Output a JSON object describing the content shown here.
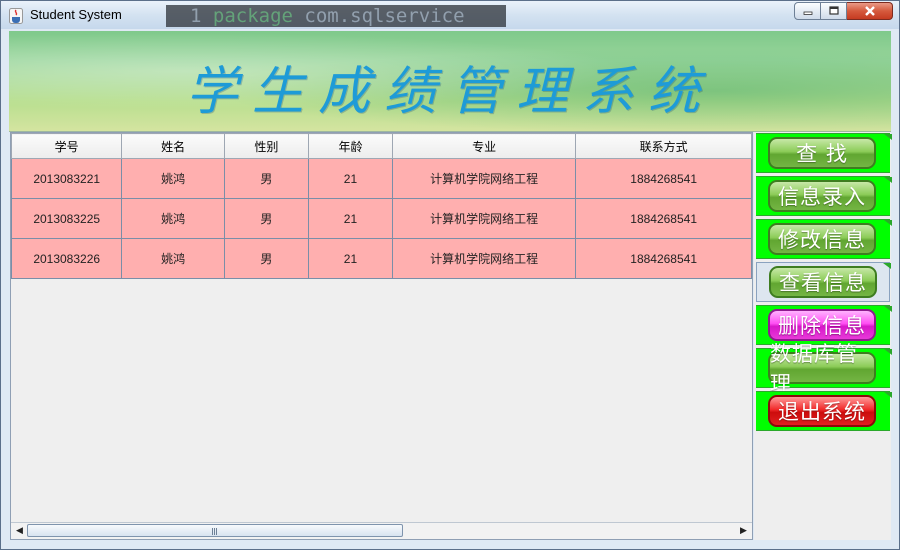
{
  "window": {
    "title": "Student System",
    "background_code": [
      "1 ",
      "package",
      " com.sqlservice"
    ]
  },
  "banner": {
    "title": "学生成绩管理系统"
  },
  "table": {
    "columns": [
      "学号",
      "姓名",
      "性别",
      "年龄",
      "专业",
      "联系方式"
    ],
    "rows": [
      [
        "2013083221",
        "姚鸿",
        "男",
        "21",
        "计算机学院网络工程",
        "1884268541"
      ],
      [
        "2013083225",
        "姚鸿",
        "男",
        "21",
        "计算机学院网络工程",
        "1884268541"
      ],
      [
        "2013083226",
        "姚鸿",
        "男",
        "21",
        "计算机学院网络工程",
        "1884268541"
      ]
    ],
    "horizontal_scroll_position": 0
  },
  "sidebar": {
    "items": [
      {
        "label": "查  找"
      },
      {
        "label": "信息录入"
      },
      {
        "label": "修改信息"
      },
      {
        "label": "查看信息"
      },
      {
        "label": "删除信息"
      },
      {
        "label": "数据库管理"
      },
      {
        "label": "退出系统"
      }
    ],
    "selected_item": "查看信息"
  },
  "colors": {
    "row_background": "#ffafaf",
    "side_tab": "#00ff00",
    "button_green": "#74b544",
    "button_magenta": "#e839d9",
    "button_red": "#e02020",
    "banner_text": "#1e9bd7"
  },
  "icons": [
    "java-app-icon",
    "minimize-icon",
    "maximize-icon",
    "close-icon",
    "scroll-left-icon",
    "scroll-right-icon"
  ]
}
